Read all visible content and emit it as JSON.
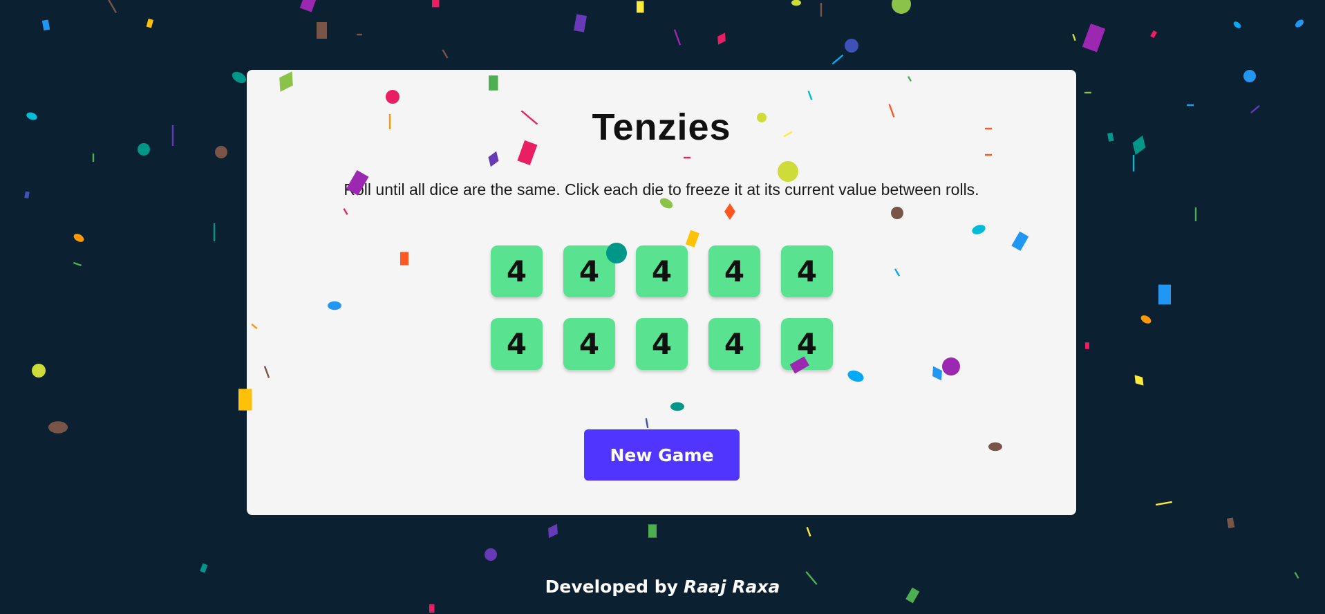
{
  "game": {
    "title": "Tenzies",
    "instructions": "Roll until all dice are the same. Click each die to freeze it at its current value between rolls.",
    "dice": [
      "4",
      "4",
      "4",
      "4",
      "4",
      "4",
      "4",
      "4",
      "4",
      "4"
    ],
    "new_game_label": "New Game"
  },
  "footer": {
    "prefix": "Developed by",
    "author": "Raaj Raxa"
  },
  "colors": {
    "background": "#0b2031",
    "card": "#f5f5f5",
    "die": "#59e391",
    "button": "#5035ff",
    "confetti": [
      "#e91e63",
      "#9c27b0",
      "#673ab7",
      "#3f51b5",
      "#2196f3",
      "#03a9f4",
      "#00bcd4",
      "#009688",
      "#4caf50",
      "#8bc34a",
      "#cddc39",
      "#ffeb3b",
      "#ffc107",
      "#ff9800",
      "#ff5722",
      "#795548"
    ]
  }
}
